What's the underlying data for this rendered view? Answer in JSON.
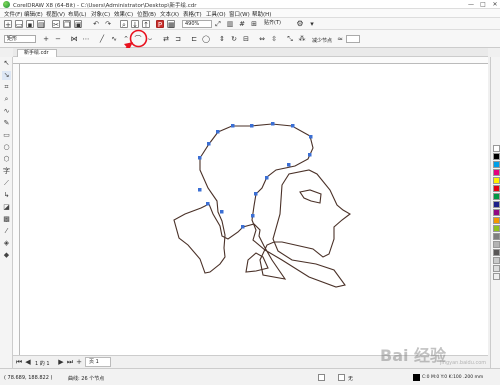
{
  "window": {
    "title": "CorelDRAW X8 (64-Bit) - C:\\Users\\Administrator\\Desktop\\新手绘.cdr",
    "minimize": "—",
    "maximize": "□",
    "close": "✕"
  },
  "menu": [
    "文件(F)",
    "编辑(E)",
    "视图(V)",
    "布局(L)",
    "对象(C)",
    "效果(C)",
    "位图(B)",
    "文本(X)",
    "表格(T)",
    "工具(O)",
    "窗口(W)",
    "帮助(H)"
  ],
  "toolbar": {
    "zoom_value": "490%",
    "snap_label": "贴齐(T)"
  },
  "property_bar": {
    "node_mode": "矩形",
    "reduce_nodes_label": "减少节点"
  },
  "document_tab": {
    "name": "新手绘.cdr"
  },
  "page_nav": {
    "position": "1 的 1",
    "page_label": "页 1"
  },
  "status": {
    "coordinates": "( 78.689, 188.822 )",
    "selection_info": "曲线: 26 个节点",
    "fill_none": "无",
    "outline_info": "C:0 M:0 Y:0 K:100 .200 mm"
  },
  "colors": {
    "path_stroke": "#4a3128",
    "node": "#3b6fd4",
    "annotation_red": "#e8121f",
    "palette": [
      "#ffffff",
      "#000000",
      "#00a0e9",
      "#e4007f",
      "#fff100",
      "#e60012",
      "#009944",
      "#1d2088",
      "#920783",
      "#f39800",
      "#8fc31f",
      "#7f7f7f",
      "#b3b3b3",
      "#595757",
      "#c9caca",
      "#dcdddd",
      "#efefef"
    ]
  },
  "watermark": {
    "text": "Bai 经验",
    "sub": "jingyan.baidu.com"
  }
}
